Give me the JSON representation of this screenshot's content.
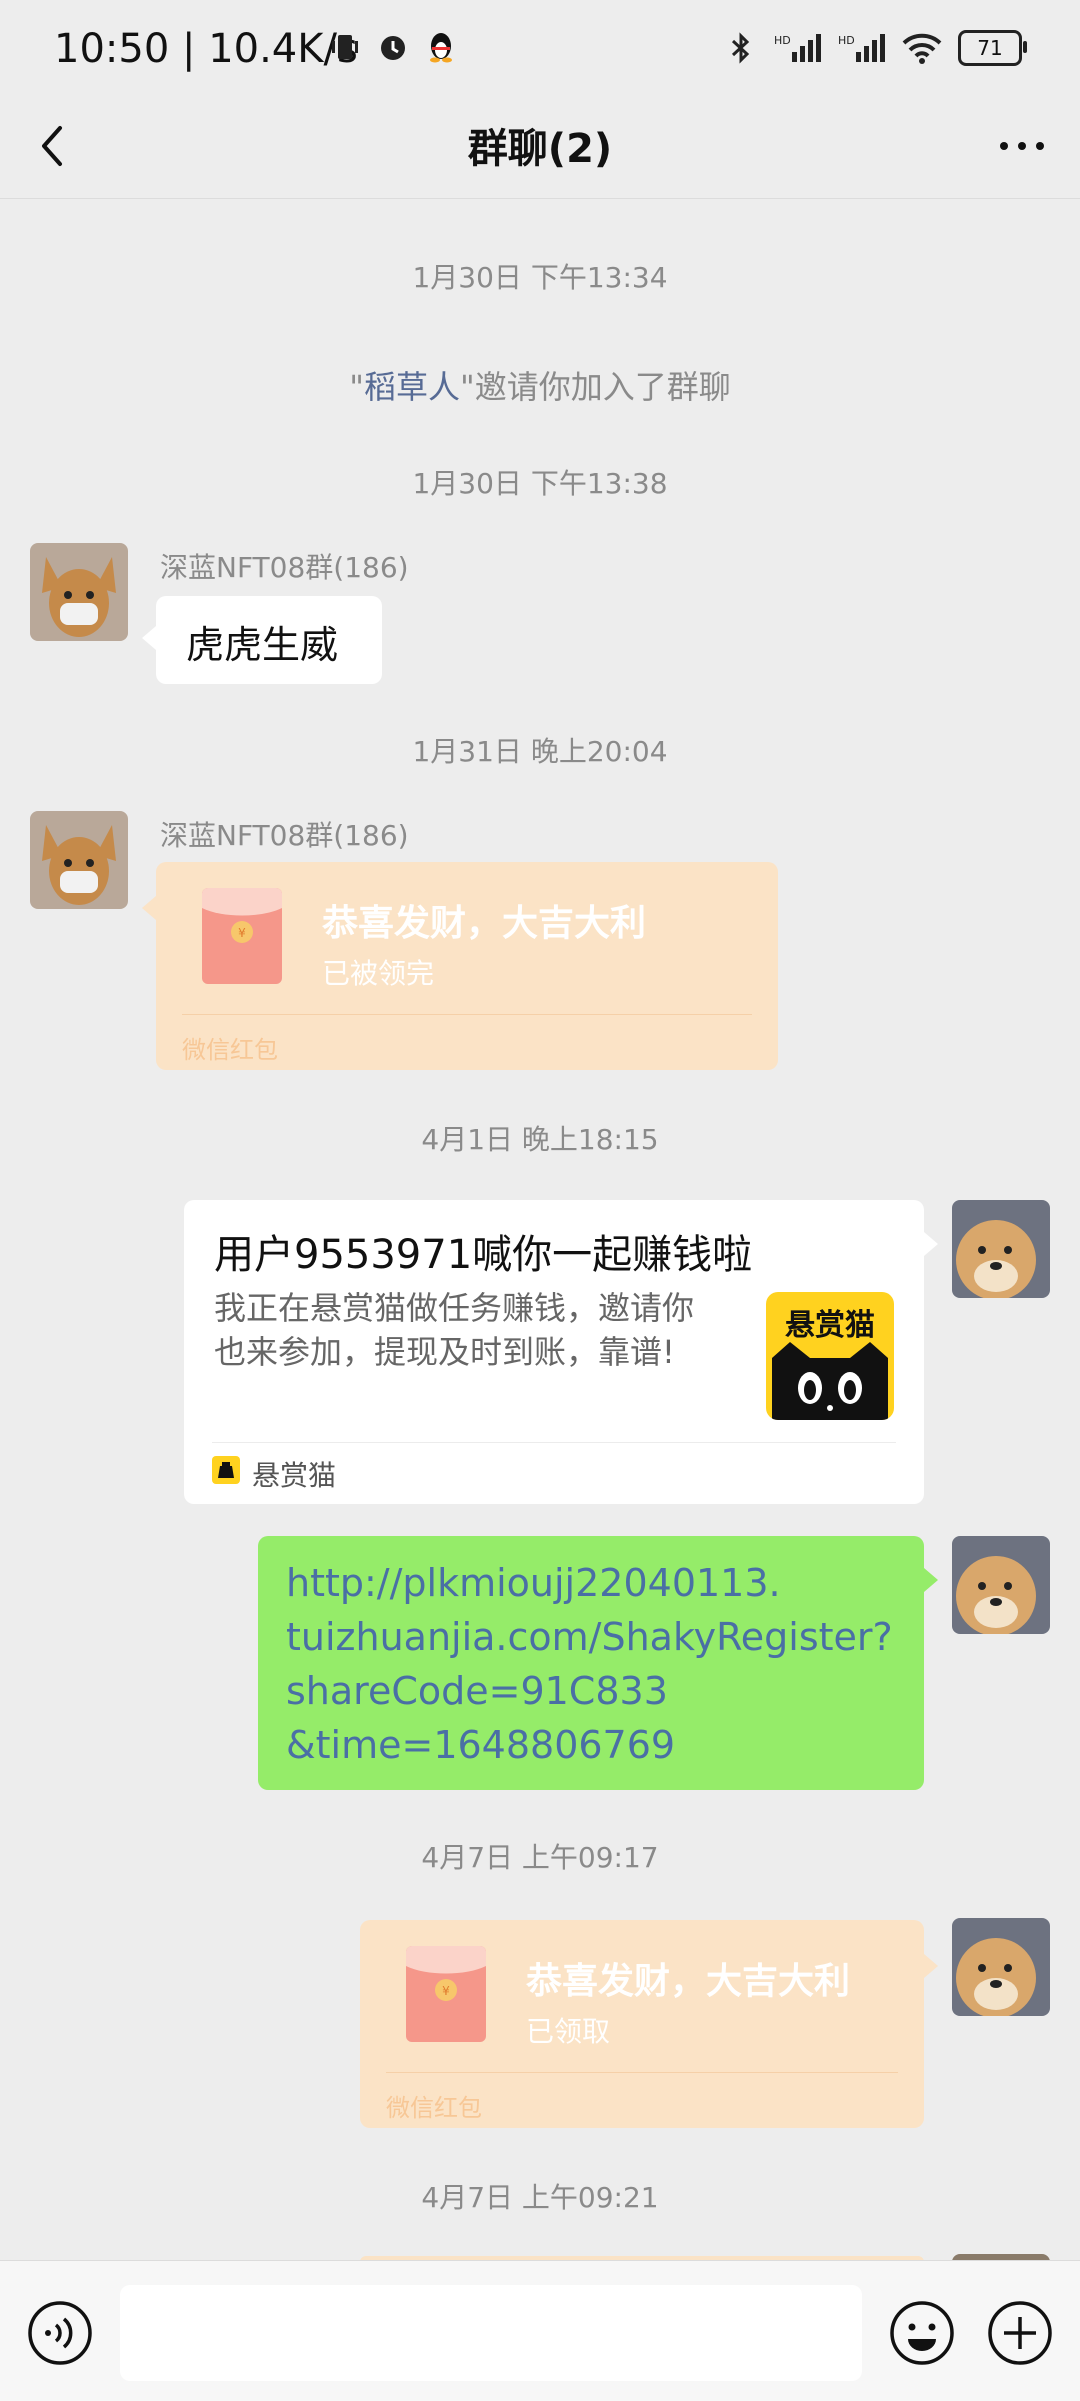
{
  "status_bar": {
    "time": "10:50",
    "speed": "10.4K/s",
    "battery": "71",
    "icons_left": [
      "vibrate-icon",
      "alarm-icon",
      "qq-penguin-icon"
    ],
    "icons_right": [
      "bluetooth-icon",
      "hd-signal-icon",
      "hd-signal-icon",
      "wifi-icon",
      "battery-icon"
    ]
  },
  "nav": {
    "title": "群聊(2)",
    "back_icon": "back-chevron-icon",
    "more_icon": "more-dots-icon"
  },
  "messages": {
    "ts1": "1月30日 下午13:34",
    "sys1": {
      "quote_open": "\"",
      "name": "稻草人",
      "rest": "\"邀请你加入了群聊"
    },
    "ts2": "1月30日 下午13:38",
    "msg1": {
      "sender": "深蓝NFT08群(186)",
      "text": "虎虎生威"
    },
    "ts3": "1月31日 晚上20:04",
    "msg2": {
      "sender": "深蓝NFT08群(186)",
      "rp_title": "恭喜发财，大吉大利",
      "rp_status": "已被领完",
      "rp_footer": "微信红包"
    },
    "ts4": "4月1日 晚上18:15",
    "card": {
      "title": "用户9553971喊你一起赚钱啦",
      "desc_line1": "我正在悬赏猫做任务赚钱，邀请你",
      "desc_line2": "也来参加，提现及时到账，靠谱!",
      "logo_text": "悬赏猫",
      "source": "悬赏猫"
    },
    "link": {
      "line1": "http://plkmioujj22040113.",
      "line2": "tuizhuanjia.com/ShakyRegister?",
      "line3": "shareCode=91C833",
      "line4": "&time=1648806769"
    },
    "ts5": "4月7日 上午09:17",
    "msg3": {
      "rp_title": "恭喜发财，大吉大利",
      "rp_status": "已领取",
      "rp_footer": "微信红包"
    },
    "ts6": "4月7日 上午09:21"
  },
  "bottom_bar": {
    "voice_icon": "voice-icon",
    "input_placeholder": "",
    "emoji_icon": "emoji-icon",
    "plus_icon": "plus-icon"
  },
  "colors": {
    "background": "#ededed",
    "green_bubble": "#95ec69",
    "red_packet": "#fbe3c6",
    "link_name": "#576b95"
  }
}
